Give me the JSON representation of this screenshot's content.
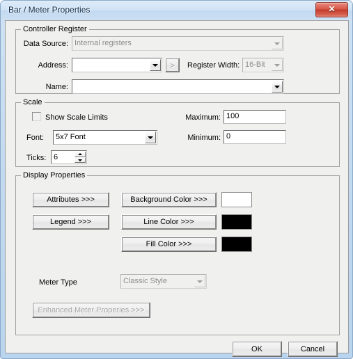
{
  "window": {
    "title": "Bar / Meter Properties",
    "close_label": "✕",
    "close_icon": "close-icon"
  },
  "controller_register": {
    "legend": "Controller Register",
    "data_source": {
      "label": "Data Source:",
      "value": "Internal registers",
      "disabled": true
    },
    "address": {
      "label": "Address:",
      "value": "",
      "browse_label": ">"
    },
    "register_width": {
      "label": "Register Width:",
      "value": "16-Bit",
      "disabled": true
    },
    "name": {
      "label": "Name:",
      "value": ""
    }
  },
  "scale": {
    "legend": "Scale",
    "show_scale_limits": {
      "label": "Show Scale Limits",
      "checked": false
    },
    "font": {
      "label": "Font:",
      "value": "5x7 Font"
    },
    "ticks": {
      "label": "Ticks:",
      "value": "6"
    },
    "maximum": {
      "label": "Maximum:",
      "value": "100"
    },
    "minimum": {
      "label": "Minimum:",
      "value": "0"
    }
  },
  "display_properties": {
    "legend": "Display Properties",
    "attributes_label": "Attributes >>>",
    "legend_button_label": "Legend >>>",
    "background_color_label": "Background Color >>>",
    "line_color_label": "Line Color >>>",
    "fill_color_label": "Fill Color >>>",
    "background_color_value": "#ffffff",
    "line_color_value": "#000000",
    "fill_color_value": "#000000",
    "meter_type": {
      "label": "Meter Type",
      "value": "Classic Style",
      "disabled": true
    },
    "enhanced_meter_properties": {
      "label": "Enhanced Meter Properies >>>",
      "disabled": true
    }
  },
  "footer": {
    "ok_label": "OK",
    "cancel_label": "Cancel"
  }
}
